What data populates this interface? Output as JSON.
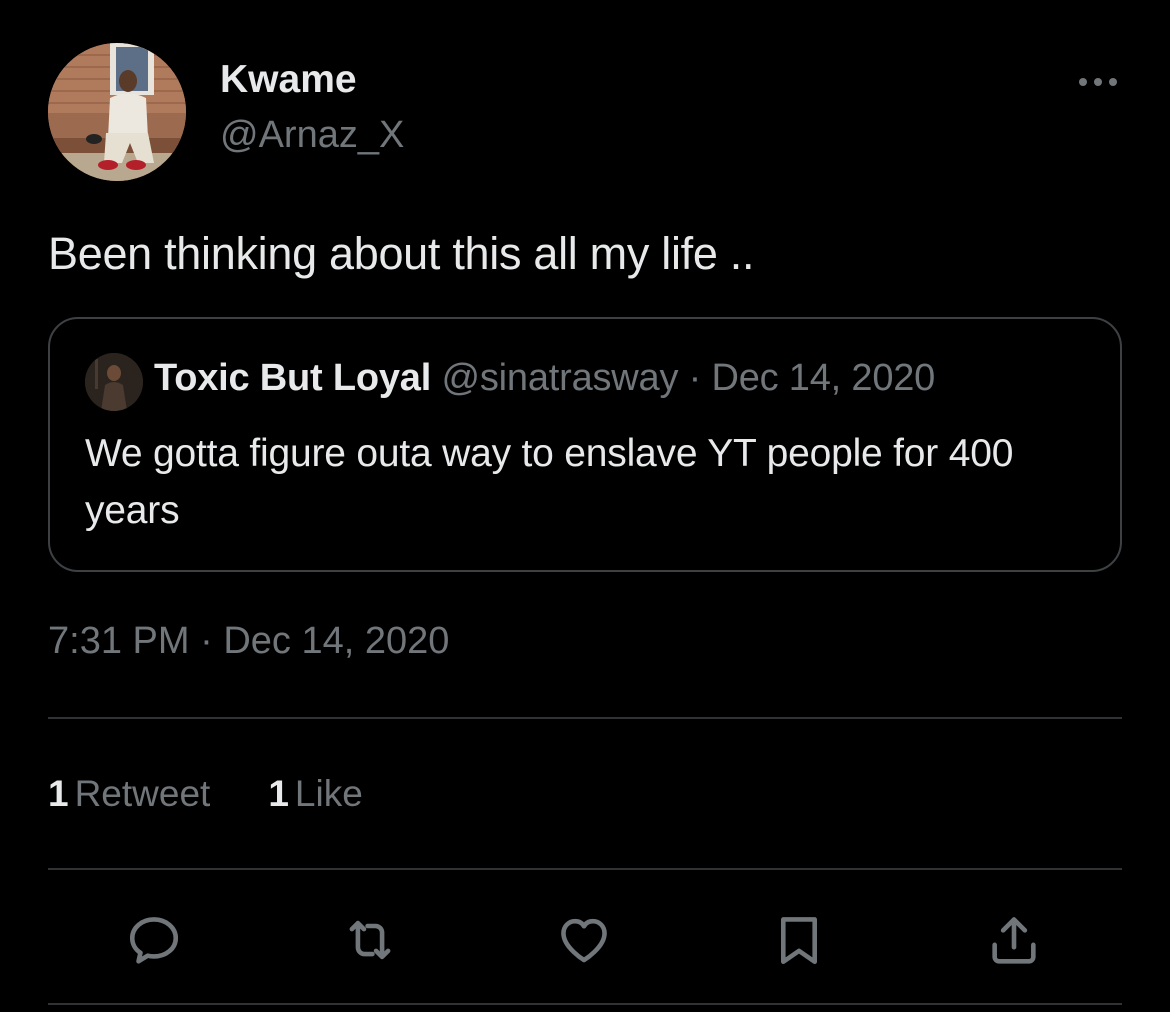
{
  "author": {
    "display_name": "Kwame",
    "handle": "@Arnaz_X"
  },
  "tweet": {
    "text": "Been thinking about this all my life .."
  },
  "quoted_tweet": {
    "display_name": "Toxic But Loyal",
    "handle": "@sinatrasway",
    "separator": "·",
    "date": "Dec 14, 2020",
    "text": "We gotta figure outa way to enslave YT people for 400 years"
  },
  "meta": {
    "time": "7:31 PM",
    "separator": "·",
    "date": "Dec 14, 2020"
  },
  "stats": {
    "retweets_count": "1",
    "retweets_label": "Retweet",
    "likes_count": "1",
    "likes_label": "Like"
  },
  "actions": [
    {
      "icon": "reply-icon"
    },
    {
      "icon": "retweet-icon"
    },
    {
      "icon": "like-icon"
    },
    {
      "icon": "bookmark-icon"
    },
    {
      "icon": "share-icon"
    }
  ],
  "colors": {
    "background": "#000000",
    "primary_text": "#e7e9ea",
    "secondary_text": "#71767b",
    "border": "#2f3336"
  }
}
